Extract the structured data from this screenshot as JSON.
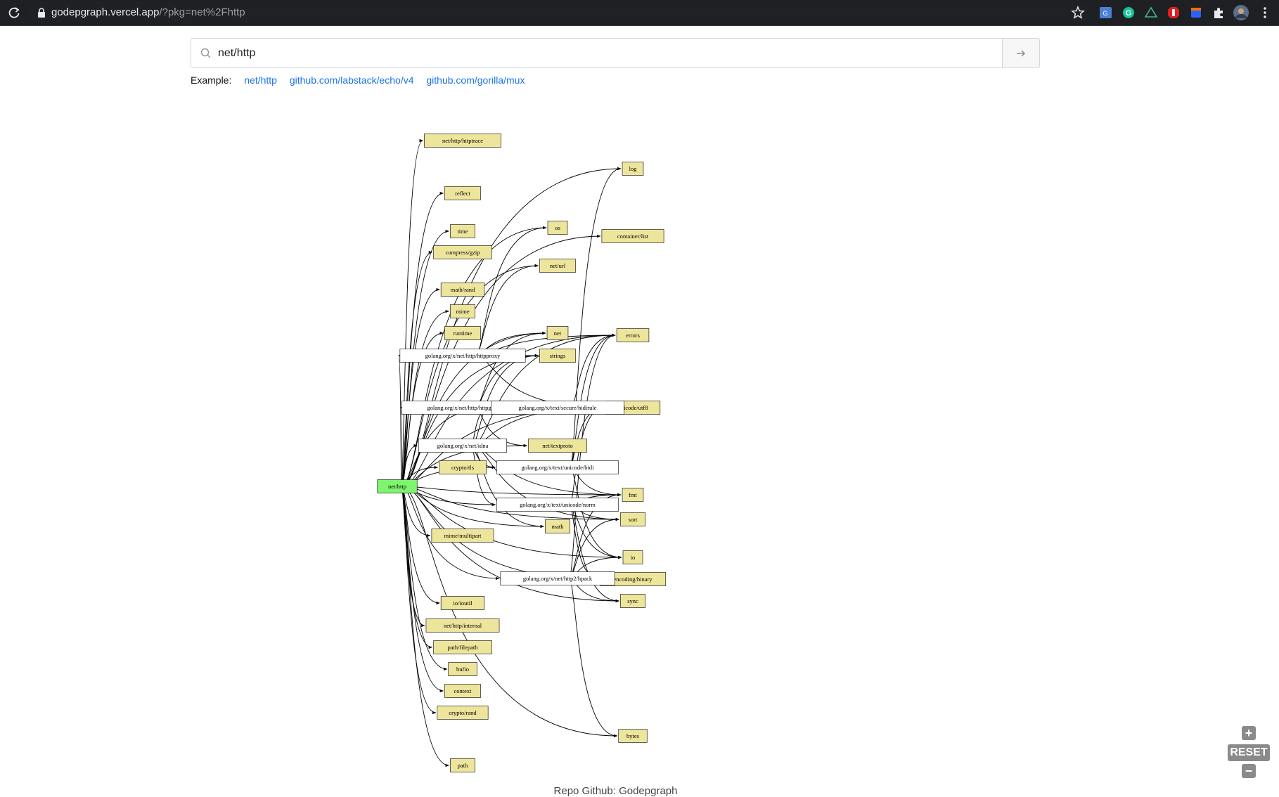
{
  "browser": {
    "url_host": "godepgraph.vercel.app",
    "url_path": "/?pkg=net%2Fhttp"
  },
  "search": {
    "value": "net/http"
  },
  "examples": {
    "label": "Example:",
    "links": [
      "net/http",
      "github.com/labstack/echo/v4",
      "github.com/gorilla/mux"
    ]
  },
  "graph": {
    "root": "net/http",
    "left_column": [
      "net/http/httptrace",
      "reflect",
      "time",
      "compress/gzip",
      "math/rand",
      "mime",
      "runtime",
      "crypto/tls",
      "mime/multipart",
      "io/ioutil",
      "net/http/internal",
      "path/filepath",
      "bufio",
      "context",
      "crypto/rand",
      "path"
    ],
    "middle_column": [
      "os",
      "net/url",
      "net",
      "strings",
      "net/textproto",
      "math"
    ],
    "right_column": [
      "log",
      "container/list",
      "errors",
      "unicode/utf8",
      "fmt",
      "sort",
      "io",
      "encoding/binary",
      "sync",
      "bytes"
    ],
    "vendor_packages": [
      "golang.org/x/net/http/httpproxy",
      "golang.org/x/net/http/httpguts",
      "golang.org/x/text/secure/bidirule",
      "golang.org/x/net/idna",
      "golang.org/x/text/unicode/bidi",
      "golang.org/x/text/unicode/norm",
      "golang.org/x/net/http2/hpack"
    ],
    "node_fill": "#ede59b",
    "root_fill": "#7ef56f",
    "vendor_fill": "#ffffff"
  },
  "controls": {
    "reset_label": "RESET"
  },
  "footer": {
    "text": "Repo Github: Godepgraph"
  }
}
